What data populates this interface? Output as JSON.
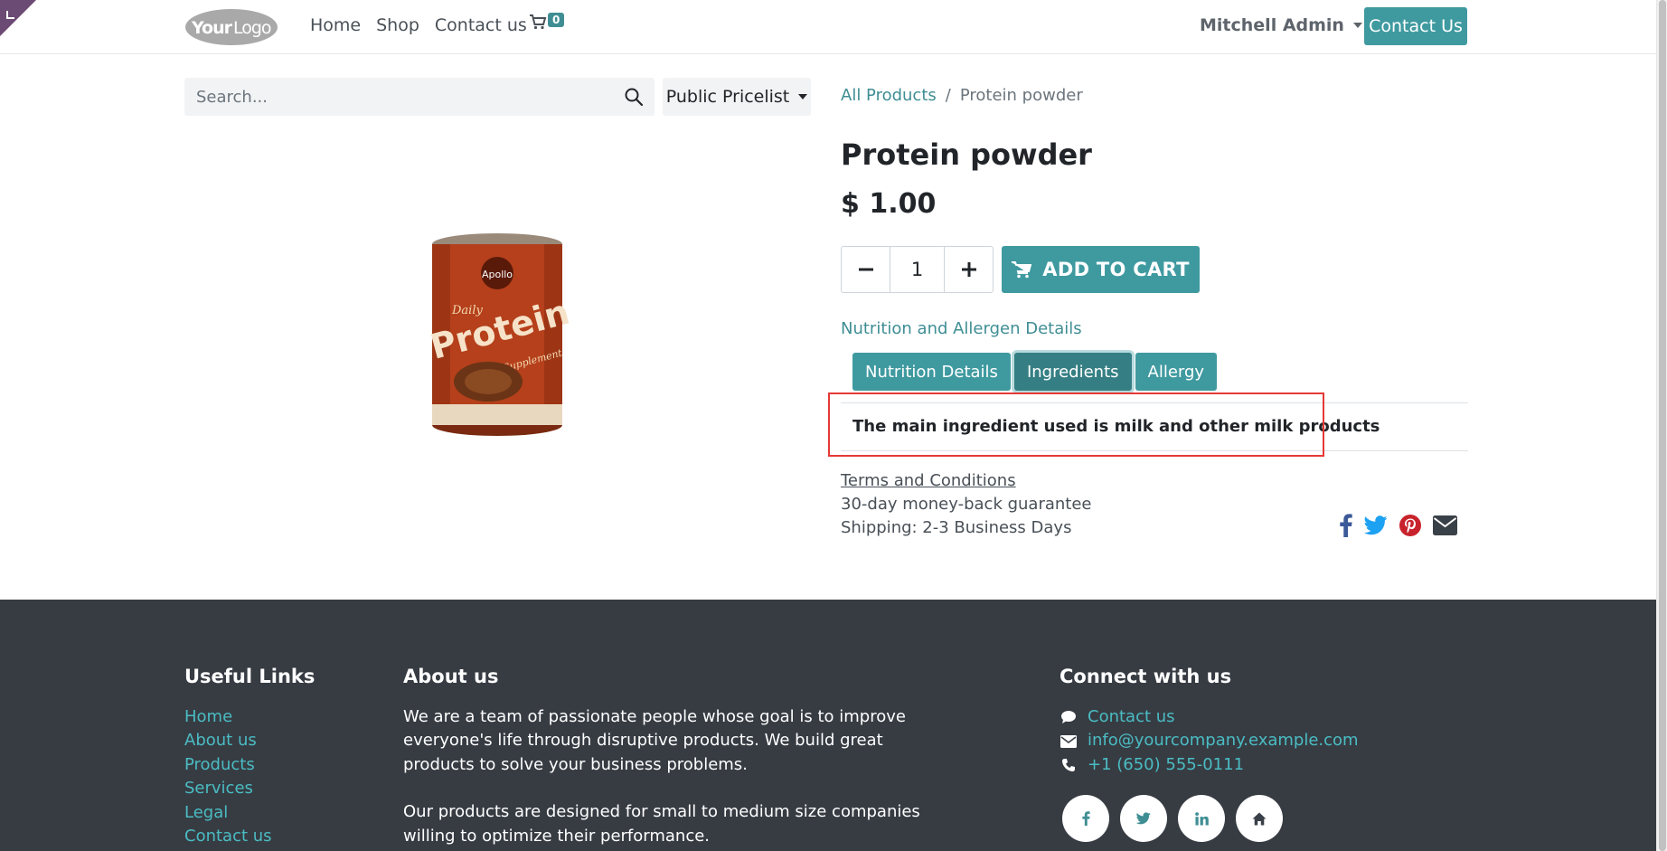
{
  "header": {
    "logo_text": "YourLogo",
    "nav": [
      "Home",
      "Shop",
      "Contact us"
    ],
    "cart_count": "0",
    "user_name": "Mitchell Admin",
    "contact_button": "Contact Us"
  },
  "search": {
    "placeholder": "Search...",
    "pricelist": "Public Pricelist"
  },
  "breadcrumb": {
    "parent": "All Products",
    "separator": "/",
    "current": "Protein powder"
  },
  "product": {
    "name": "Protein powder",
    "price": "$ 1.00",
    "quantity": "1",
    "add_to_cart": "ADD TO CART",
    "image_label": "Apollo Daily Protein Supplement"
  },
  "details": {
    "section_title": "Nutrition and Allergen Details",
    "tabs": [
      "Nutrition Details",
      "Ingredients",
      "Allergy"
    ],
    "active_tab": "Ingredients",
    "ingredient_text": "The main ingredient used is milk and other milk products"
  },
  "terms": {
    "link": "Terms and Conditions",
    "guarantee": "30-day money-back guarantee",
    "shipping": "Shipping: 2-3 Business Days"
  },
  "share_icons": [
    "facebook-icon",
    "twitter-icon",
    "pinterest-icon",
    "envelope-icon"
  ],
  "footer": {
    "useful_links_title": "Useful Links",
    "useful_links": [
      "Home",
      "About us",
      "Products",
      "Services",
      "Legal",
      "Contact us"
    ],
    "about_title": "About us",
    "about_p1": "We are a team of passionate people whose goal is to improve everyone's life through disruptive products. We build great products to solve your business problems.",
    "about_p2": "Our products are designed for small to medium size companies willing to optimize their performance.",
    "connect_title": "Connect with us",
    "contact_link": "Contact us",
    "email": "info@yourcompany.example.com",
    "phone": "+1 (650) 555-0111",
    "social": [
      "f",
      "t",
      "in",
      "home"
    ]
  },
  "colors": {
    "primary": "#3f9aa0",
    "link": "#3f8e94",
    "footer_bg": "#373c43",
    "footer_link": "#4bbcc3",
    "highlight": "#e53935"
  }
}
